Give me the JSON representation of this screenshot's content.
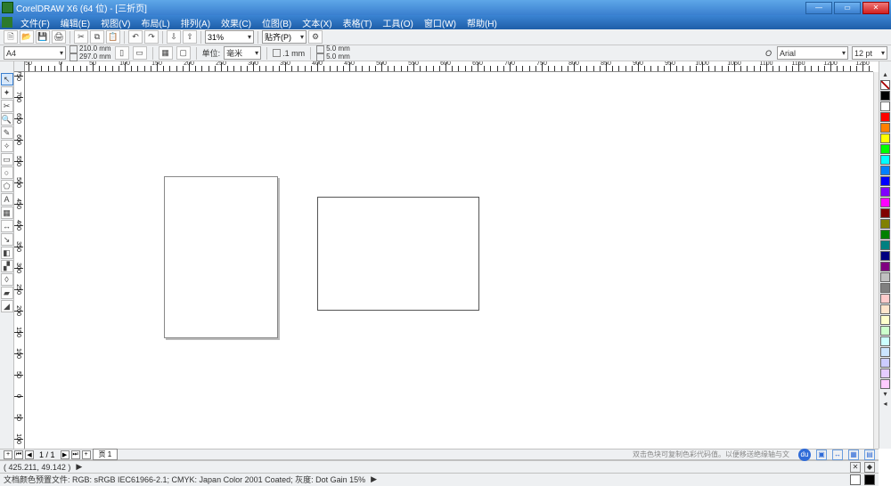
{
  "title": "CorelDRAW X6 (64 位) - [三折页]",
  "menu": {
    "items": [
      "文件(F)",
      "编辑(E)",
      "视图(V)",
      "布局(L)",
      "排列(A)",
      "效果(C)",
      "位图(B)",
      "文本(X)",
      "表格(T)",
      "工具(O)",
      "窗口(W)",
      "帮助(H)"
    ]
  },
  "toolbar": {
    "zoom": "31%",
    "snap_label": "贴齐(P)"
  },
  "property": {
    "paper": "A4",
    "width": "210.0 mm",
    "height": "297.0 mm",
    "units_label": "单位:",
    "units_value": "毫米",
    "nudge": ".1 mm",
    "dup_x": "5.0 mm",
    "dup_y": "5.0 mm",
    "font": "Arial",
    "font_size": "12 pt"
  },
  "ruler": {
    "h_labels": [
      "50",
      "0",
      "50",
      "100",
      "150",
      "200",
      "250",
      "300",
      "350",
      "400",
      "450",
      "500",
      "550",
      "600",
      "650",
      "700",
      "750",
      "800",
      "850",
      "900",
      "950",
      "1000",
      "1050",
      "1100",
      "1150",
      "1200",
      "1250"
    ],
    "v_labels": [
      "750",
      "700",
      "650",
      "600",
      "550",
      "500",
      "450",
      "400",
      "350",
      "300",
      "250",
      "200",
      "150",
      "100",
      "50",
      "0",
      "50",
      "100"
    ]
  },
  "toolbox": {
    "tools": [
      "pick",
      "shape",
      "crop",
      "zoom",
      "freehand",
      "smart",
      "rect",
      "ellipse",
      "polygon",
      "text",
      "table",
      "dimension",
      "connector",
      "effects",
      "eyedrop",
      "fill",
      "outline",
      "interactive-fill"
    ]
  },
  "palette": {
    "colors": [
      "none",
      "#000000",
      "#ffffff",
      "#ff0000",
      "#ff8000",
      "#ffff00",
      "#00ff00",
      "#00ffff",
      "#0080ff",
      "#0000ff",
      "#8000ff",
      "#ff00ff",
      "#800000",
      "#808000",
      "#008000",
      "#008080",
      "#000080",
      "#800080",
      "#c0c0c0",
      "#808080",
      "#ffcccc",
      "#ffe5cc",
      "#ffffcc",
      "#ccffcc",
      "#ccffff",
      "#cce5ff",
      "#ccccff",
      "#e5ccff",
      "#ffccff"
    ]
  },
  "page_nav": {
    "counter": "1 / 1",
    "tab": "页 1"
  },
  "hint": "双击色块可复制色彩代码值。以便移送绝缘轴与文",
  "status": {
    "coords": "( 425.211, 49.142 )",
    "profile": "文档颜色预置文件: RGB: sRGB IEC61966-2.1; CMYK: Japan Color 2001 Coated; 灰度: Dot Gain 15%"
  }
}
